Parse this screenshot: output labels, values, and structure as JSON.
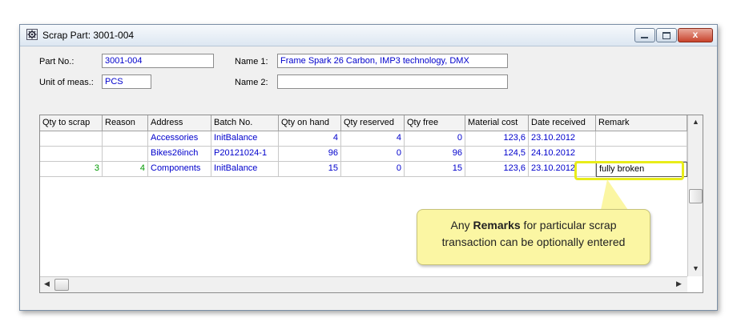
{
  "window": {
    "title": "Scrap Part: 3001-004",
    "close_glyph": "x"
  },
  "form": {
    "part_no_label": "Part No.:",
    "part_no_value": "3001-004",
    "uom_label": "Unit of meas.:",
    "uom_value": "PCS",
    "name1_label": "Name 1:",
    "name1_value": "Frame Spark 26 Carbon, IMP3 technology, DMX",
    "name2_label": "Name 2:",
    "name2_value": ""
  },
  "grid": {
    "columns": [
      "Qty to scrap",
      "Reason",
      "Address",
      "Batch No.",
      "Qty on hand",
      "Qty reserved",
      "Qty free",
      "Material cost",
      "Date received",
      "Remark"
    ],
    "rows": [
      {
        "qty_to_scrap": "",
        "reason": "",
        "address": "Accessories",
        "batch": "InitBalance",
        "qty_on_hand": "4",
        "qty_reserved": "4",
        "qty_free": "0",
        "material_cost": "123,6",
        "date_received": "23.10.2012",
        "remark": ""
      },
      {
        "qty_to_scrap": "",
        "reason": "",
        "address": "Bikes26inch",
        "batch": "P20121024-1",
        "qty_on_hand": "96",
        "qty_reserved": "0",
        "qty_free": "96",
        "material_cost": "124,5",
        "date_received": "24.10.2012",
        "remark": ""
      },
      {
        "qty_to_scrap": "3",
        "reason": "4",
        "address": "Components",
        "batch": "InitBalance",
        "qty_on_hand": "15",
        "qty_reserved": "0",
        "qty_free": "15",
        "material_cost": "123,6",
        "date_received": "23.10.2012",
        "remark": "fully broken"
      }
    ]
  },
  "callout": {
    "prefix": "Any ",
    "bold": "Remarks",
    "line1_rest": " for particular scrap",
    "line2": "transaction can be optionally entered"
  },
  "icons": {
    "app": "gear-icon"
  },
  "colors": {
    "value_text": "#0000cc",
    "edited_text": "#009900",
    "callout_bg": "#fbf6a3",
    "highlight": "#e8ec1a"
  }
}
